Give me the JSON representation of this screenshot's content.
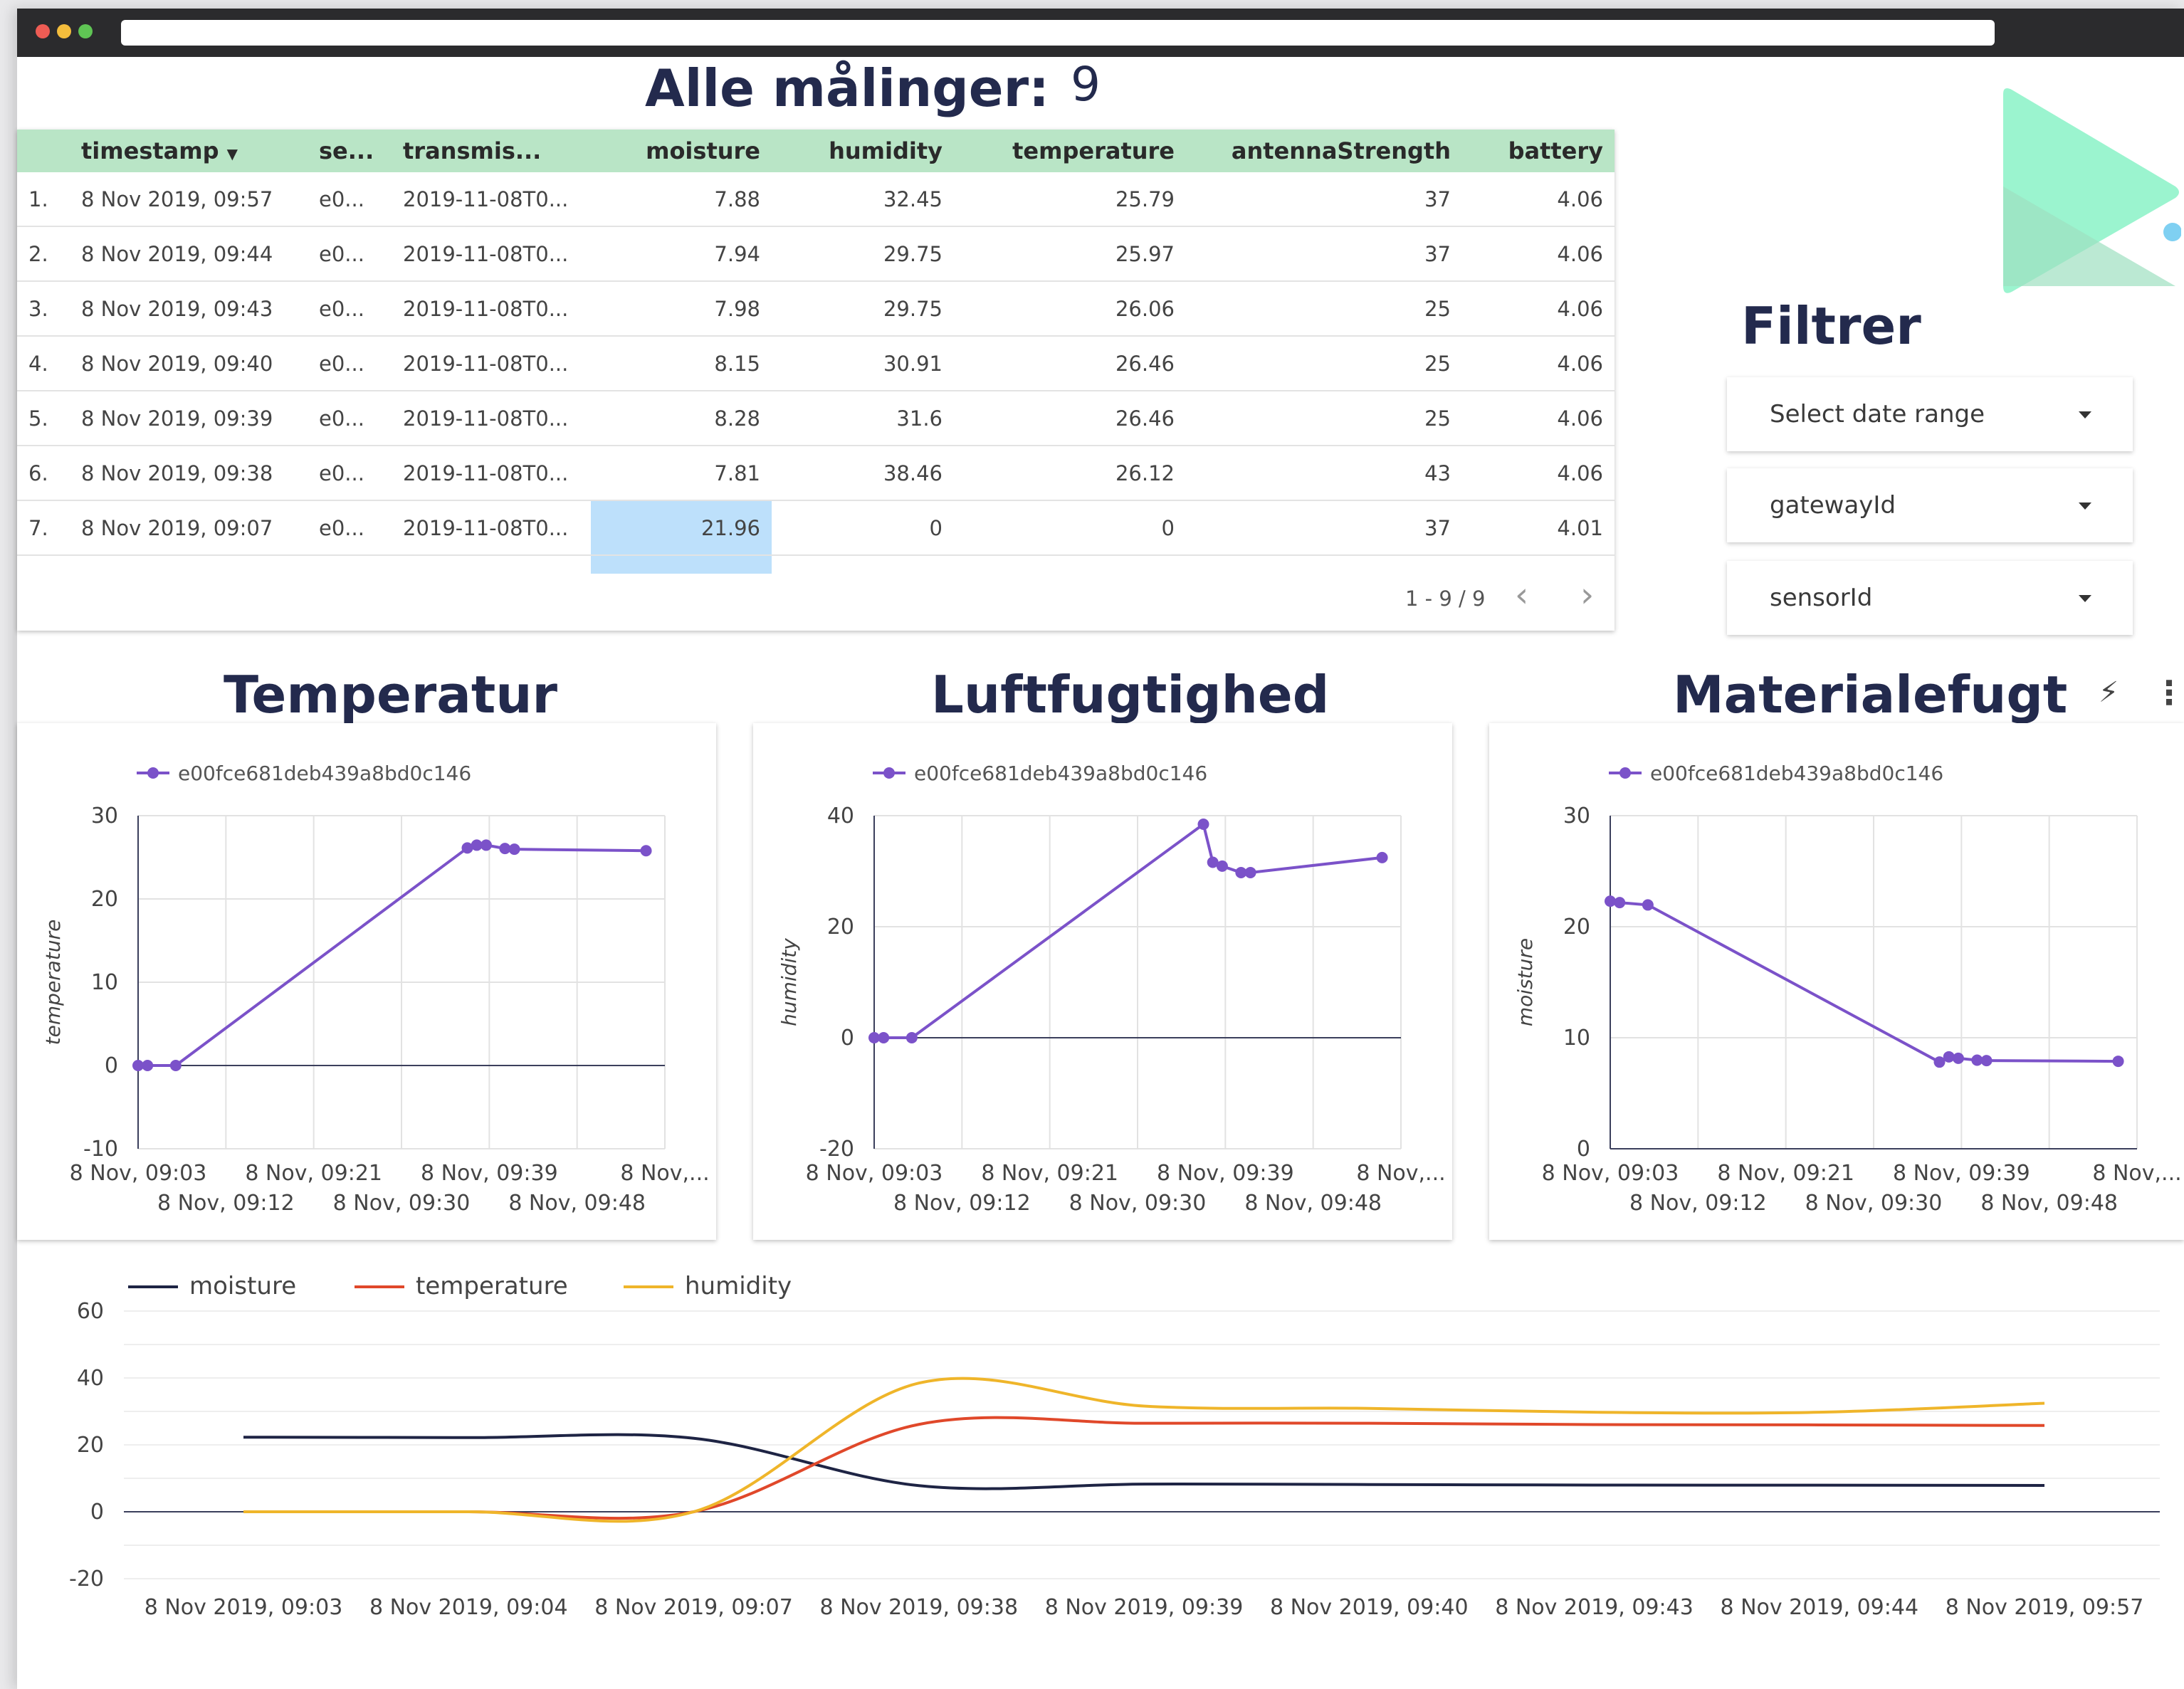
{
  "header": {
    "title": "Alle målinger:",
    "count": "9"
  },
  "table": {
    "columns": [
      "timestamp",
      "se...",
      "transmis...",
      "moisture",
      "humidity",
      "temperature",
      "antennaStrength",
      "battery"
    ],
    "rows": [
      [
        "1.",
        "8 Nov 2019, 09:57",
        "e0...",
        "2019-11-08T0...",
        "7.88",
        "32.45",
        "25.79",
        "37",
        "4.06"
      ],
      [
        "2.",
        "8 Nov 2019, 09:44",
        "e0...",
        "2019-11-08T0...",
        "7.94",
        "29.75",
        "25.97",
        "37",
        "4.06"
      ],
      [
        "3.",
        "8 Nov 2019, 09:43",
        "e0...",
        "2019-11-08T0...",
        "7.98",
        "29.75",
        "26.06",
        "25",
        "4.06"
      ],
      [
        "4.",
        "8 Nov 2019, 09:40",
        "e0...",
        "2019-11-08T0...",
        "8.15",
        "30.91",
        "26.46",
        "25",
        "4.06"
      ],
      [
        "5.",
        "8 Nov 2019, 09:39",
        "e0...",
        "2019-11-08T0...",
        "8.28",
        "31.6",
        "26.46",
        "25",
        "4.06"
      ],
      [
        "6.",
        "8 Nov 2019, 09:38",
        "e0...",
        "2019-11-08T0...",
        "7.81",
        "38.46",
        "26.12",
        "43",
        "4.06"
      ],
      [
        "7.",
        "8 Nov 2019, 09:07",
        "e0...",
        "2019-11-08T0...",
        "21.96",
        "0",
        "0",
        "37",
        "4.01"
      ]
    ],
    "pagination": "1 - 9 / 9",
    "sort_indicator": "▼"
  },
  "filter": {
    "title": "Filtrer",
    "date_range": "Select date range",
    "gateway": "gatewayId",
    "sensor": "sensorId"
  },
  "icons": {
    "bolt": "⚡",
    "more": "⋮",
    "prev": "‹",
    "next": "›"
  },
  "colors": {
    "accent": "#7b52c9",
    "header_green": "#b9e5c6",
    "highlight": "#bde0fb",
    "title_navy": "#232a4d",
    "moisture_line": "#1e2444",
    "temperature_line": "#e0482a",
    "humidity_line": "#efb52a"
  },
  "charts": {
    "temperature_title": "Temperatur",
    "humidity_title": "Luftfugtighed",
    "moisture_title": "Materialefugt"
  },
  "chart_data": [
    {
      "type": "line",
      "title": "Temperatur",
      "ylabel": "temperature",
      "legend": [
        "e00fce681deb439a8bd0c146"
      ],
      "ylim": [
        -10,
        30
      ],
      "yticks": [
        30,
        20,
        10,
        0,
        -10
      ],
      "xticks_row1": [
        "8 Nov, 09:03",
        "8 Nov, 09:21",
        "8 Nov, 09:39",
        "8 Nov,..."
      ],
      "xticks_row2": [
        "8 Nov, 09:12",
        "8 Nov, 09:30",
        "8 Nov, 09:48"
      ],
      "x_minutes": [
        0,
        1,
        4,
        35,
        36,
        37,
        39,
        40,
        54
      ],
      "values": [
        0,
        0,
        0,
        26.12,
        26.46,
        26.46,
        26.06,
        25.97,
        25.79
      ]
    },
    {
      "type": "line",
      "title": "Luftfugtighed",
      "ylabel": "humidity",
      "legend": [
        "e00fce681deb439a8bd0c146"
      ],
      "ylim": [
        -20,
        40
      ],
      "yticks": [
        40,
        20,
        0,
        -20
      ],
      "xticks_row1": [
        "8 Nov, 09:03",
        "8 Nov, 09:21",
        "8 Nov, 09:39",
        "8 Nov,..."
      ],
      "xticks_row2": [
        "8 Nov, 09:12",
        "8 Nov, 09:30",
        "8 Nov, 09:48"
      ],
      "x_minutes": [
        0,
        1,
        4,
        35,
        36,
        37,
        39,
        40,
        54
      ],
      "values": [
        0,
        0,
        0,
        38.46,
        31.6,
        30.91,
        29.75,
        29.75,
        32.45
      ]
    },
    {
      "type": "line",
      "title": "Materialefugt",
      "ylabel": "moisture",
      "legend": [
        "e00fce681deb439a8bd0c146"
      ],
      "ylim": [
        0,
        30
      ],
      "yticks": [
        30,
        20,
        10,
        0
      ],
      "xticks_row1": [
        "8 Nov, 09:03",
        "8 Nov, 09:21",
        "8 Nov, 09:39",
        "8 Nov,..."
      ],
      "xticks_row2": [
        "8 Nov, 09:12",
        "8 Nov, 09:30",
        "8 Nov, 09:48"
      ],
      "x_minutes": [
        0,
        1,
        4,
        35,
        36,
        37,
        39,
        40,
        54
      ],
      "values": [
        22.3,
        22.17,
        21.96,
        7.81,
        8.28,
        8.15,
        7.98,
        7.94,
        7.88
      ]
    },
    {
      "type": "line",
      "ylim": [
        -20,
        60
      ],
      "yticks": [
        60,
        40,
        20,
        0,
        -20
      ],
      "categories": [
        "8 Nov 2019, 09:03",
        "8 Nov 2019, 09:04",
        "8 Nov 2019, 09:07",
        "8 Nov 2019, 09:38",
        "8 Nov 2019, 09:39",
        "8 Nov 2019, 09:40",
        "8 Nov 2019, 09:43",
        "8 Nov 2019, 09:44",
        "8 Nov 2019, 09:57"
      ],
      "series": [
        {
          "name": "moisture",
          "values": [
            22.3,
            22.17,
            21.96,
            7.81,
            8.28,
            8.15,
            7.98,
            7.94,
            7.88
          ]
        },
        {
          "name": "temperature",
          "values": [
            0,
            0,
            0,
            26.12,
            26.46,
            26.46,
            26.06,
            25.97,
            25.79
          ]
        },
        {
          "name": "humidity",
          "values": [
            0,
            0,
            0,
            38.46,
            31.6,
            30.91,
            29.75,
            29.75,
            32.45
          ]
        }
      ]
    }
  ]
}
